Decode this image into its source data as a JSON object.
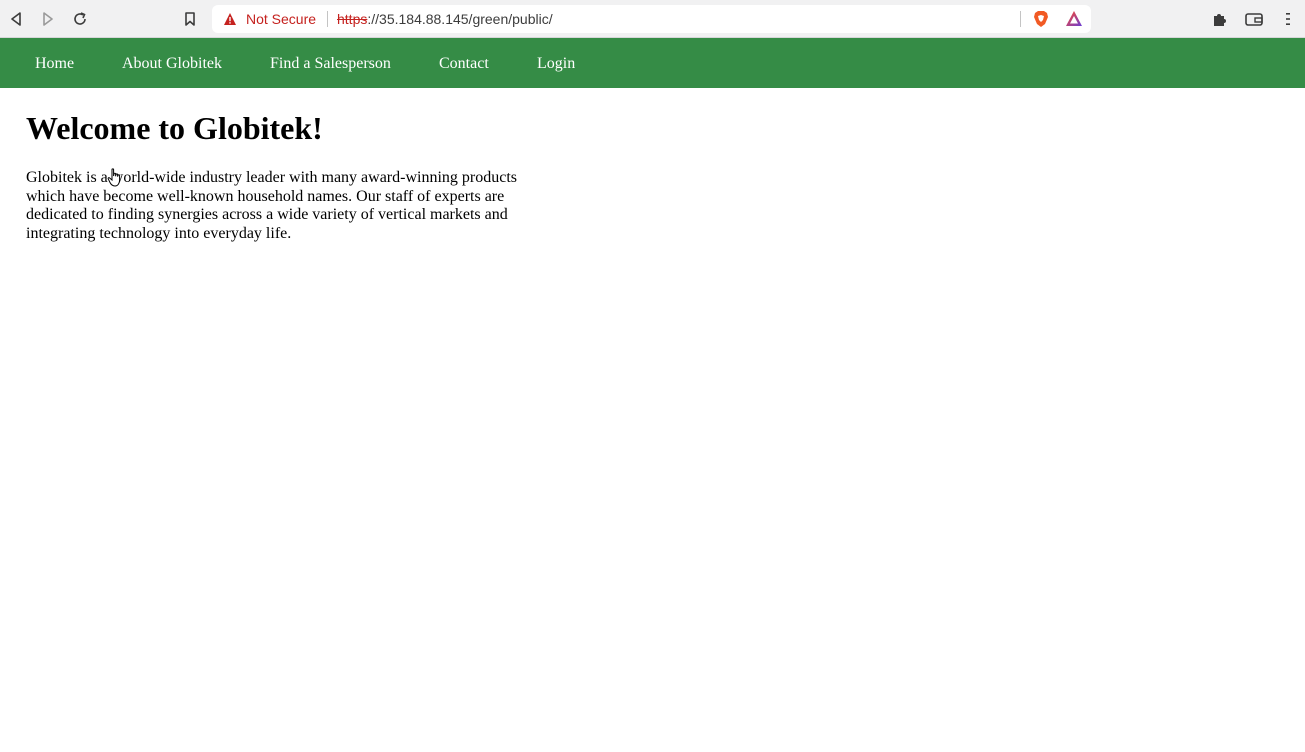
{
  "browser": {
    "security_label": "Not Secure",
    "url_scheme": "https",
    "url_rest": "://35.184.88.145/green/public/",
    "icons": {
      "back": "back-arrow-icon",
      "forward": "forward-arrow-icon",
      "reload": "reload-icon",
      "bookmark": "bookmark-icon",
      "warning": "warning-triangle-icon",
      "brave": "brave-shield-icon",
      "rewards": "brave-rewards-icon",
      "extensions": "puzzle-icon",
      "wallet": "wallet-icon",
      "menu": "hamburger-menu-icon"
    }
  },
  "nav": {
    "color": "#358c46",
    "items": [
      {
        "label": "Home"
      },
      {
        "label": "About Globitek"
      },
      {
        "label": "Find a Salesperson"
      },
      {
        "label": "Contact"
      },
      {
        "label": "Login"
      }
    ]
  },
  "main": {
    "title": "Welcome to Globitek!",
    "intro": "Globitek is a world-wide industry leader with many award-winning products which have become well-known household names. Our staff of experts are dedicated to finding synergies across a wide variety of vertical markets and integrating technology into everyday life."
  }
}
